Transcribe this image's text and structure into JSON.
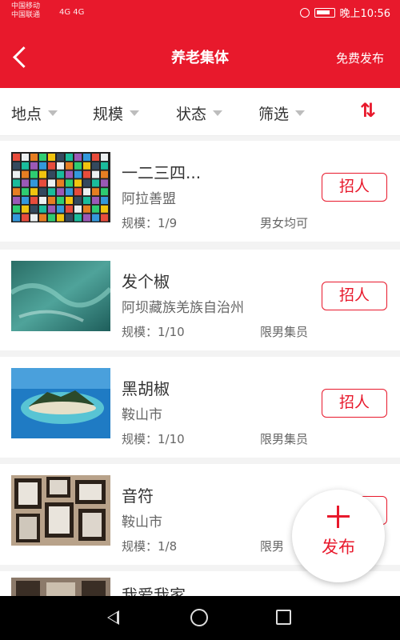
{
  "status_bar": {
    "carrier1": "中国移动",
    "carrier2": "中国联通",
    "signal": "4G 4G",
    "time": "晚上10:56"
  },
  "header": {
    "title": "养老集体",
    "publish": "免费发布"
  },
  "filters": [
    {
      "label": "地点"
    },
    {
      "label": "规模"
    },
    {
      "label": "状态"
    },
    {
      "label": "筛选"
    }
  ],
  "sort_icon": "sort-icon",
  "items": [
    {
      "name": "一二三四...",
      "location": "阿拉善盟",
      "scale": "规模：1/9",
      "gender": "男女均可",
      "button": "招人",
      "image": "colorful-grid"
    },
    {
      "name": "发个椒",
      "location": "阿坝藏族羌族自治州",
      "scale": "规模：1/10",
      "gender": "限男集员",
      "button": "招人",
      "image": "green-water"
    },
    {
      "name": "黑胡椒",
      "location": "鞍山市",
      "scale": "规模：1/10",
      "gender": "限男集员",
      "button": "招人",
      "image": "island"
    },
    {
      "name": "音符",
      "location": "鞍山市",
      "scale": "规模：1/8",
      "gender": "限男",
      "button": "招人",
      "image": "picture-frames"
    },
    {
      "name": "我爱我家",
      "location": "",
      "scale": "",
      "gender": "",
      "button": "",
      "image": "photos"
    }
  ],
  "fab": {
    "label": "发布"
  },
  "colors": {
    "brand": "#e8192c"
  }
}
